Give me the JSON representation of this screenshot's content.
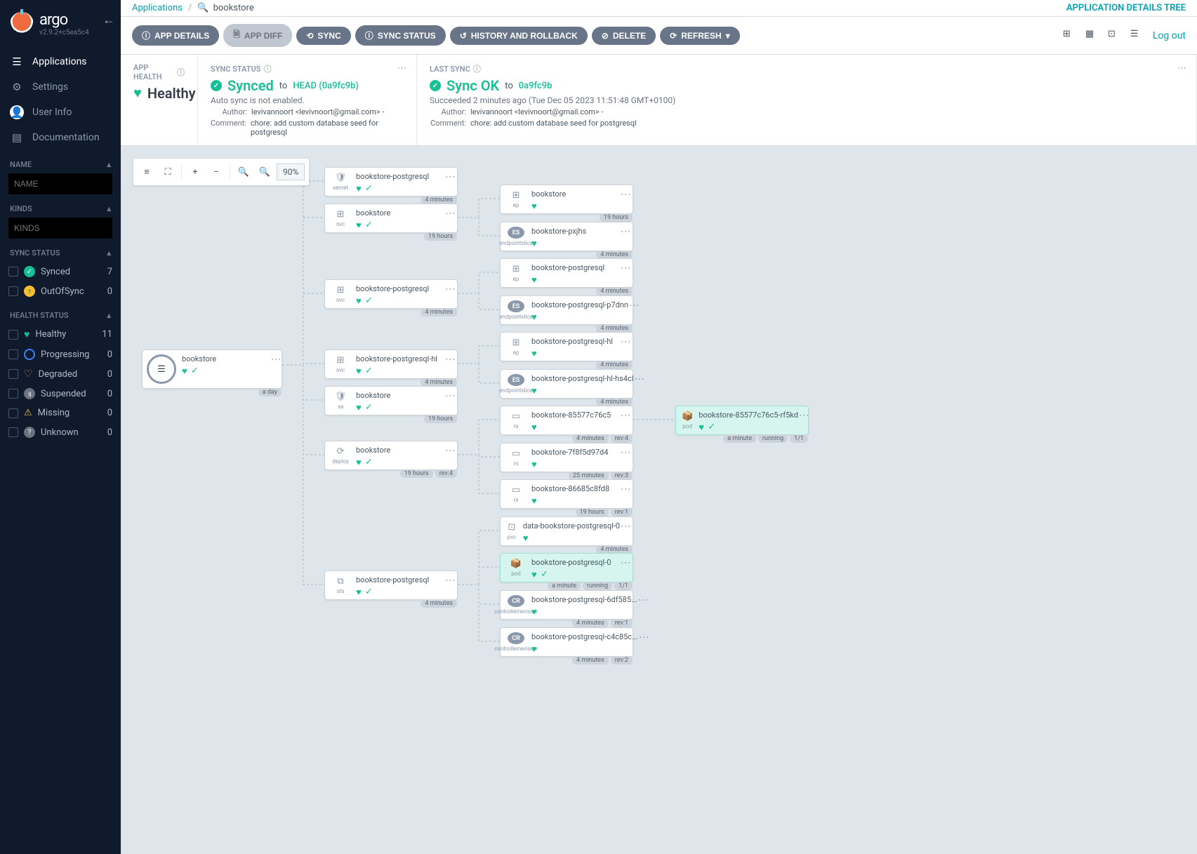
{
  "brand": "argo",
  "version": "v2.9.2+c5ea5c4",
  "nav": {
    "applications": "Applications",
    "settings": "Settings",
    "user": "User Info",
    "docs": "Documentation"
  },
  "filters": {
    "name_label": "NAME",
    "name_placeholder": "NAME",
    "kinds_label": "KINDS",
    "kinds_placeholder": "KINDS",
    "sync_label": "SYNC STATUS",
    "synced": {
      "label": "Synced",
      "count": "7"
    },
    "outofsync": {
      "label": "OutOfSync",
      "count": "0"
    },
    "health_label": "HEALTH STATUS",
    "healthy": {
      "label": "Healthy",
      "count": "11"
    },
    "progressing": {
      "label": "Progressing",
      "count": "0"
    },
    "degraded": {
      "label": "Degraded",
      "count": "0"
    },
    "suspended": {
      "label": "Suspended",
      "count": "0"
    },
    "missing": {
      "label": "Missing",
      "count": "0"
    },
    "unknown": {
      "label": "Unknown",
      "count": "0"
    }
  },
  "breadcrumb": {
    "root": "Applications",
    "current": "bookstore"
  },
  "page_title": "APPLICATION DETAILS TREE",
  "toolbar": {
    "details": "APP DETAILS",
    "diff": "APP DIFF",
    "sync": "SYNC",
    "sync_status": "SYNC STATUS",
    "history": "HISTORY AND ROLLBACK",
    "delete": "DELETE",
    "refresh": "REFRESH",
    "logout": "Log out"
  },
  "status": {
    "health_label": "APP HEALTH",
    "health_value": "Healthy",
    "sync_label": "SYNC STATUS",
    "sync_value": "Synced",
    "sync_to": "to",
    "sync_head": "HEAD (0a9fc9b)",
    "autosync": "Auto sync is not enabled.",
    "author_k": "Author:",
    "author_v": "levivannoort <levivnoort@gmail.com> -",
    "comment_k": "Comment:",
    "comment_v": "chore: add custom database seed for postgresql",
    "last_label": "LAST SYNC",
    "last_value": "Sync OK",
    "last_to": "to",
    "last_rev": "0a9fc9b",
    "succeeded": "Succeeded 2 minutes ago (Tue Dec 05 2023 11:51:48 GMT+0100)"
  },
  "zoom": "90%",
  "tree": {
    "root": {
      "name": "bookstore",
      "age": "a day"
    },
    "c1": [
      {
        "name": "bookstore-postgresql",
        "kind": "secret",
        "age": "4 minutes"
      },
      {
        "name": "bookstore",
        "kind": "svc",
        "age": "19 hours"
      },
      {
        "name": "bookstore-postgresql",
        "kind": "svc",
        "age": "4 minutes"
      },
      {
        "name": "bookstore-postgresql-hl",
        "kind": "svc",
        "age": "4 minutes"
      },
      {
        "name": "bookstore",
        "kind": "sa",
        "age": "19 hours"
      },
      {
        "name": "bookstore",
        "kind": "deploy",
        "age": "19 hours",
        "rev": "rev:4"
      },
      {
        "name": "bookstore-postgresql",
        "kind": "sts",
        "age": "4 minutes"
      }
    ],
    "c2": [
      {
        "name": "bookstore",
        "kind": "ep",
        "age": "19 hours"
      },
      {
        "name": "bookstore-pxjhs",
        "kind": "endpointslice",
        "age": "4 minutes"
      },
      {
        "name": "bookstore-postgresql",
        "kind": "ep",
        "age": "4 minutes"
      },
      {
        "name": "bookstore-postgresql-p7dnn",
        "kind": "endpointslice",
        "age": "4 minutes"
      },
      {
        "name": "bookstore-postgresql-hl",
        "kind": "ep",
        "age": "4 minutes"
      },
      {
        "name": "bookstore-postgresql-hl-hs4cl",
        "kind": "endpointslice",
        "age": "4 minutes"
      },
      {
        "name": "bookstore-85577c76c5",
        "kind": "rs",
        "age": "4 minutes",
        "rev": "rev:4"
      },
      {
        "name": "bookstore-7f8f5d97d4",
        "kind": "rs",
        "age": "25 minutes",
        "rev": "rev:3"
      },
      {
        "name": "bookstore-86685c8fd8",
        "kind": "rs",
        "age": "19 hours",
        "rev": "rev:1"
      },
      {
        "name": "data-bookstore-postgresql-0",
        "kind": "pvc",
        "age": "4 minutes"
      },
      {
        "name": "bookstore-postgresql-0",
        "kind": "pod",
        "age": "a minute",
        "running": "running",
        "frac": "1/1",
        "hl": true
      },
      {
        "name": "bookstore-postgresql-6df585...",
        "kind": "controllerrevision",
        "age": "4 minutes",
        "rev": "rev:1"
      },
      {
        "name": "bookstore-postgresql-c4c85c...",
        "kind": "controllerrevision",
        "age": "4 minutes",
        "rev": "rev:2"
      }
    ],
    "c3": [
      {
        "name": "bookstore-85577c76c5-rf5kd",
        "kind": "pod",
        "age": "a minute",
        "running": "running",
        "frac": "1/1",
        "hl": true
      }
    ]
  }
}
